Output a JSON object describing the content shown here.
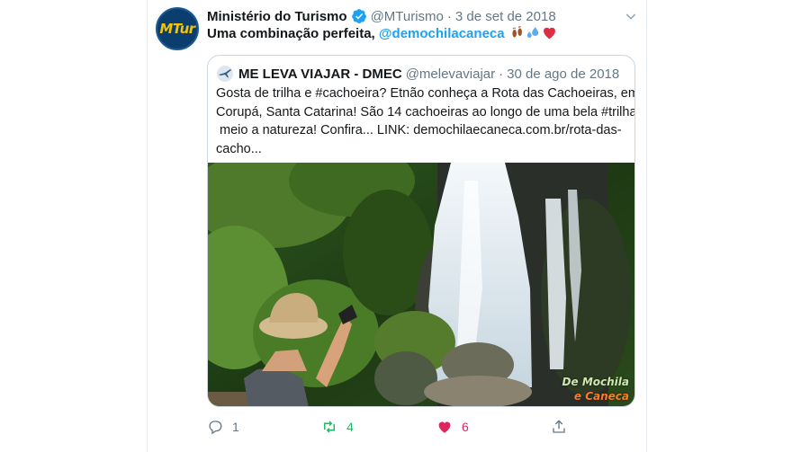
{
  "tweet": {
    "author": {
      "name": "Ministério do Turismo",
      "handle": "@MTurismo",
      "avatar_text": "MTur",
      "verified": true
    },
    "separator": "·",
    "date": "3 de set de 2018",
    "text_prefix": "Uma combinação perfeita, ",
    "mention": "@demochilacaneca",
    "emojis": [
      "footprints-emoji",
      "sweat-droplets-emoji",
      "red-heart-emoji"
    ],
    "quoted": {
      "author": {
        "name": "ME LEVA VIAJAR - DMEC",
        "handle": "@melevaviajar"
      },
      "date": "30 de ago de 2018",
      "text_lines": [
        "Gosta de trilha e #cachoeira? Etnão conheça a Rota das Cachoeiras, em",
        "Corupá, Santa Catarina! São 14 cachoeiras ao longo de uma bela #trilha",
        " meio a natureza! Confira... LINK: demochilaecaneca.com.br/rota-das-",
        "cacho..."
      ],
      "image": {
        "watermark_line1": "De Mochila",
        "watermark_line2": "e Caneca"
      }
    },
    "actions": {
      "replies": "1",
      "retweets": "4",
      "likes": "6"
    }
  },
  "colors": {
    "link": "#1da1f2",
    "muted": "#657786",
    "retweet_active": "#17bf63",
    "like_active": "#e0245e",
    "verified": "#1da1f2"
  }
}
